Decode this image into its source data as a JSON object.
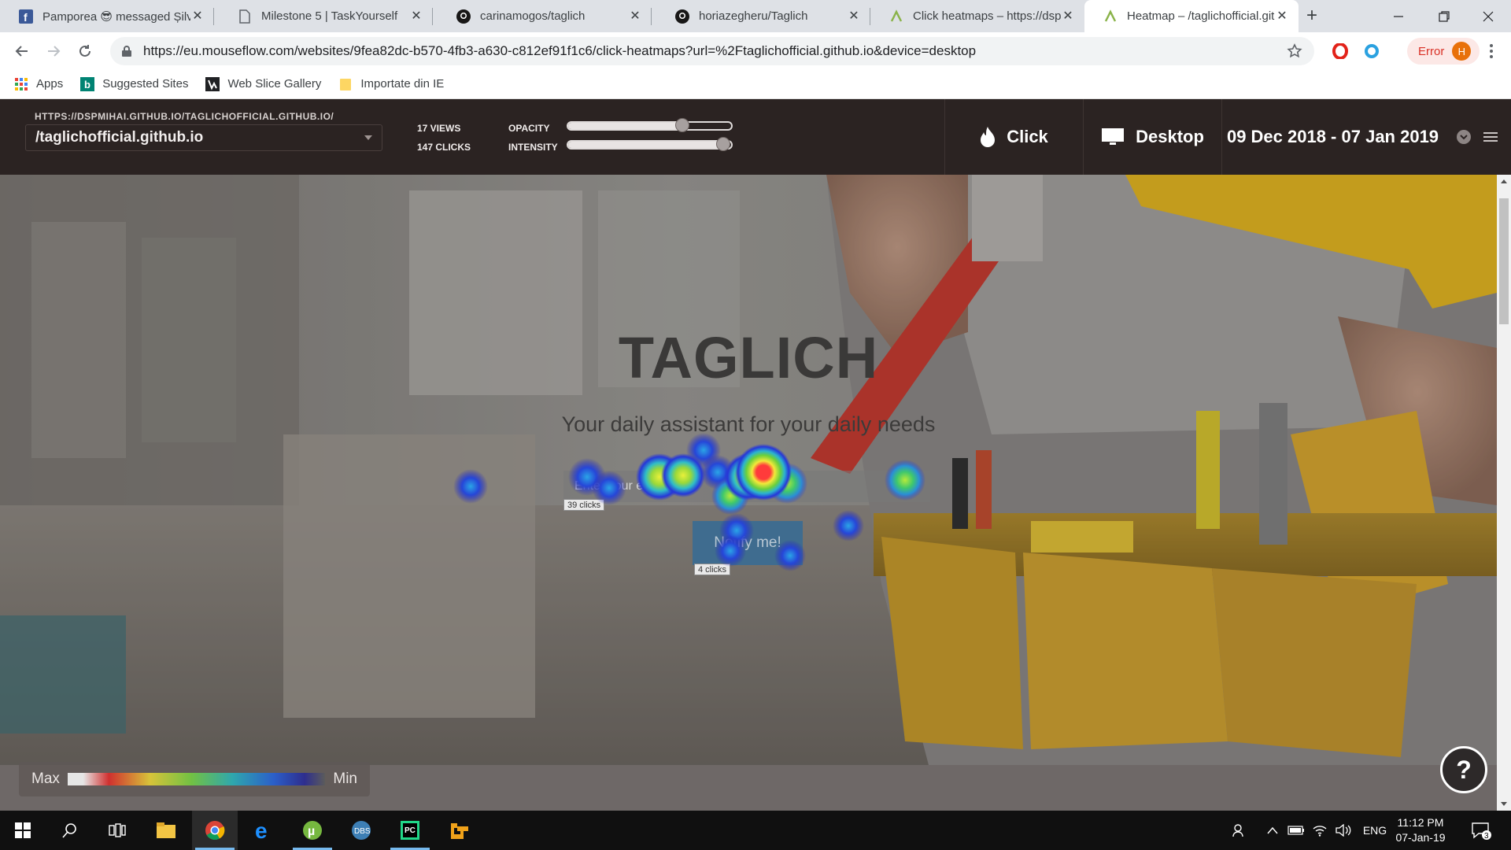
{
  "browser": {
    "tabs": [
      {
        "title": "Pamporea 😎 messaged Șilvia",
        "icon": "facebook-icon",
        "active": false
      },
      {
        "title": "Milestone 5 | TaskYourself",
        "icon": "document-icon",
        "active": false
      },
      {
        "title": "carinamogos/taglich",
        "icon": "github-icon",
        "active": false
      },
      {
        "title": "horiazegheru/Taglich",
        "icon": "github-icon",
        "active": false
      },
      {
        "title": "Click heatmaps – https://dspmihai",
        "icon": "mouseflow-icon",
        "active": false
      },
      {
        "title": "Heatmap – /taglichofficial.github.io",
        "icon": "mouseflow-icon",
        "active": true
      }
    ],
    "url": "https://eu.mouseflow.com/websites/9fea82dc-b570-4fb3-a630-c812ef91f1c6/click-heatmaps?url=%2Ftaglichofficial.github.io&device=desktop",
    "profile_status": "Error",
    "profile_initial": "H",
    "bookmarks": [
      {
        "label": "Apps",
        "icon": "apps-grid-icon"
      },
      {
        "label": "Suggested Sites",
        "icon": "bing-icon"
      },
      {
        "label": "Web Slice Gallery",
        "icon": "web-slice-icon"
      },
      {
        "label": "Importate din IE",
        "icon": "folder-icon"
      }
    ]
  },
  "mouseflow": {
    "url_caption": "HTTPS://DSPMIHAI.GITHUB.IO/TAGLICHOFFICIAL.GITHUB.IO/",
    "url_selected": "/taglichofficial.github.io",
    "views": "17 VIEWS",
    "clicks": "147 CLICKS",
    "opacity_label": "OPACITY",
    "intensity_label": "INTENSITY",
    "opacity_value": 0.7,
    "intensity_value": 0.95,
    "heatmap_type": "Click",
    "device": "Desktop",
    "date_range": "09 Dec 2018 - 07 Jan 2019"
  },
  "page": {
    "title": "TAGLICH",
    "subtitle": "Your daily assistant for your daily needs",
    "email_placeholder": "Enter your email",
    "notify_button": "Notify me!",
    "email_clicks": "39 clicks",
    "button_clicks": "4 clicks"
  },
  "legend": {
    "max": "Max",
    "min": "Min"
  },
  "help_label": "?",
  "taskbar": {
    "language": "ENG",
    "time": "11:12 PM",
    "date": "07-Jan-19",
    "notifications": "3"
  },
  "colors": {
    "mouseflow_header": "#2b2322",
    "chrome_tabstrip": "#dee1e6",
    "heat_max": "#e53030",
    "heat_min": "#2b2ba8",
    "error_red": "#d93025"
  }
}
